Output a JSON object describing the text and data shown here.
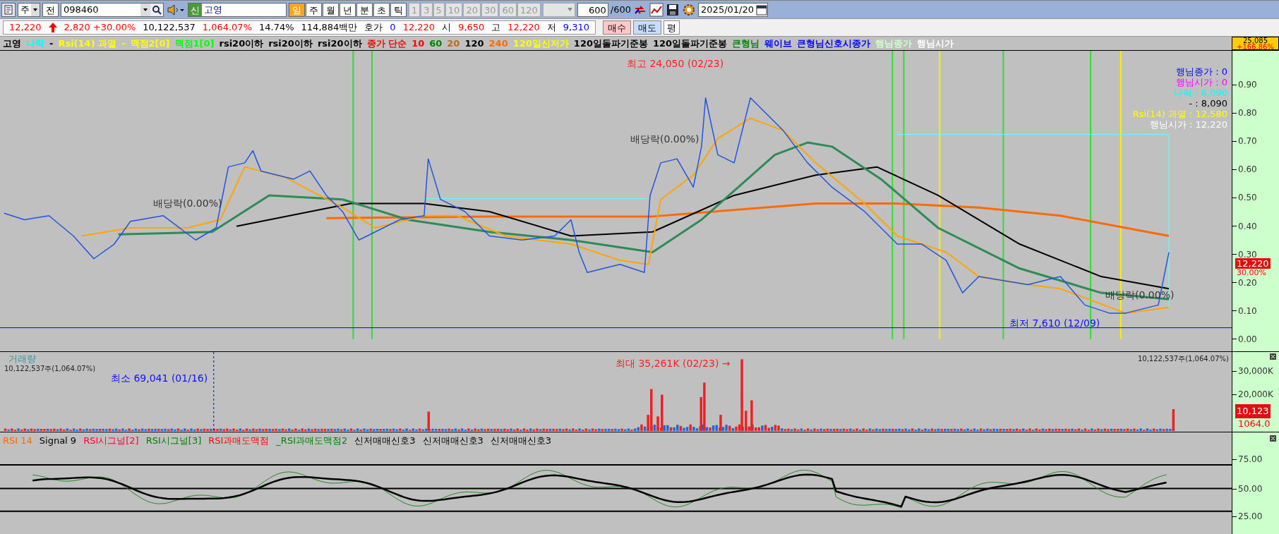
{
  "toolbar": {
    "market": "주",
    "prev_button": "전",
    "code": "098460",
    "name_badge": "신",
    "name": "고영",
    "periods": [
      {
        "label": "일",
        "selected": true
      },
      {
        "label": "주",
        "selected": false
      },
      {
        "label": "월",
        "selected": false
      },
      {
        "label": "년",
        "selected": false
      },
      {
        "label": "분",
        "selected": false
      },
      {
        "label": "초",
        "selected": false
      },
      {
        "label": "틱",
        "selected": false
      }
    ],
    "intervals": [
      {
        "label": "1",
        "disabled": true
      },
      {
        "label": "3",
        "disabled": true
      },
      {
        "label": "5",
        "disabled": true
      },
      {
        "label": "10",
        "disabled": true
      },
      {
        "label": "20",
        "disabled": true
      },
      {
        "label": "30",
        "disabled": true
      },
      {
        "label": "60",
        "disabled": true
      },
      {
        "label": "120",
        "disabled": true
      }
    ],
    "count": "600",
    "count_total": "/600",
    "date": "2025/01/20"
  },
  "quote_bar": {
    "items": [
      {
        "text": "12,220",
        "kind": "rise"
      },
      {
        "text": "2,820 +30.00%",
        "kind": "rise"
      },
      {
        "text": "10,122,537",
        "kind": "neutral"
      },
      {
        "text": "1,064.07%",
        "kind": "rise"
      },
      {
        "text": "14.74%",
        "kind": "neutral"
      },
      {
        "text": "114,884백만",
        "kind": "neutral"
      },
      {
        "text": "호가",
        "kind": "neutral"
      },
      {
        "text": "0",
        "kind": "fall"
      },
      {
        "text": "12,220",
        "kind": "rise"
      },
      {
        "text": "시",
        "kind": "neutral"
      },
      {
        "text": "9,650",
        "kind": "rise"
      },
      {
        "text": "고",
        "kind": "neutral"
      },
      {
        "text": "12,220",
        "kind": "rise"
      },
      {
        "text": "저",
        "kind": "neutral"
      },
      {
        "text": "9,310",
        "kind": "fall"
      }
    ],
    "buttons": [
      {
        "label": "매수",
        "kind": "buy"
      },
      {
        "label": "매도",
        "kind": "sell"
      },
      {
        "label": "평",
        "kind": "plain"
      }
    ]
  },
  "legend": [
    {
      "text": "고영",
      "color": "#000000"
    },
    {
      "text": "나락",
      "color": "#00ffff"
    },
    {
      "text": "-",
      "color": "#000000"
    },
    {
      "text": "Rsi(14) 과열",
      "color": "#ffff00"
    },
    {
      "text": "-",
      "color": "#ffff00"
    },
    {
      "text": "맥점2[0]",
      "color": "#ffff00"
    },
    {
      "text": "맥점1[0]",
      "color": "#00ff00"
    },
    {
      "text": "rsi20이하",
      "color": "#000000"
    },
    {
      "text": "rsi20이하",
      "color": "#000000"
    },
    {
      "text": "rsi20이하",
      "color": "#000000"
    },
    {
      "text": "종가 단순",
      "color": "#ff0000"
    },
    {
      "text": "10",
      "color": "#ff0000"
    },
    {
      "text": "60",
      "color": "#008000"
    },
    {
      "text": "20",
      "color": "#b86e00"
    },
    {
      "text": "120",
      "color": "#000000"
    },
    {
      "text": "240",
      "color": "#ff6a00"
    },
    {
      "text": "120일신저가",
      "color": "#ffff00"
    },
    {
      "text": "120일돌파기준봉",
      "color": "#000000"
    },
    {
      "text": "120일돌파기준봉",
      "color": "#000000"
    },
    {
      "text": "큰형님",
      "color": "#008800"
    },
    {
      "text": "웨이브",
      "color": "#0000ff"
    },
    {
      "text": "큰형님신호시종가",
      "color": "#0000ff"
    },
    {
      "text": "행님종가",
      "color": "#ccffcc"
    },
    {
      "text": "행님시가",
      "color": "#ffffff"
    }
  ],
  "price_panel": {
    "high_price": "25,085",
    "high_change": "+166.86%",
    "annotations": [
      {
        "text": "최고 24,050 (02/23)",
        "kind": "high"
      },
      {
        "text": "배당락(0.00%)",
        "kind": "dividend"
      },
      {
        "text": "배당락(0.00%)",
        "kind": "dividend"
      },
      {
        "text": "배당락(0.00%)",
        "kind": "dividend"
      },
      {
        "text": "최저 7,610 (12/09)",
        "kind": "low"
      }
    ],
    "overlay_texts": [
      {
        "text": "행님종가 : 0",
        "color": "#0000ff"
      },
      {
        "text": "행님시가 : 0",
        "color": "#ff00ff"
      },
      {
        "text": "나락 : 8,090",
        "color": "#00ffff"
      },
      {
        "text": "- : 8,090",
        "color": "#000000"
      },
      {
        "text": "Rsi(14) 과열 : 12,580",
        "color": "#ffff00"
      },
      {
        "text": "행님시가 : 12,220",
        "color": "#ffffff"
      }
    ],
    "axis_labels": [
      "0.90",
      "0.80",
      "0.70",
      "0.60",
      "0.50",
      "0.40",
      "0.30",
      "0.20",
      "0.10",
      "0.00"
    ],
    "current_price": "12,220",
    "current_change": "30.00%"
  },
  "volume_panel": {
    "title": "거래량",
    "volume_text": "10,122,537주(1,064.07%)",
    "volume_text_right": "10,122,537주(1,064.07%)",
    "max_label": "최대 35,261K (02/23) →",
    "min_label": "최소 69,041 (01/16)",
    "axis_labels": [
      "30,000K",
      "20,000K"
    ],
    "current_volume": "10,123",
    "current_ratio": "1064.0"
  },
  "rsi_panel": {
    "legend": [
      {
        "text": "RSI 14",
        "color": "#ff6600"
      },
      {
        "text": "Signal 9",
        "color": "#000000"
      },
      {
        "text": "RSI시그널[2]",
        "color": "#ff0033"
      },
      {
        "text": "RSI시그널[3]",
        "color": "#008000"
      },
      {
        "text": "RSI과매도맥점",
        "color": "#ff0000"
      },
      {
        "text": "_RSI과매도맥점2",
        "color": "#008000"
      },
      {
        "text": "신저매매신호3",
        "color": "#000000"
      },
      {
        "text": "신저매매신호3",
        "color": "#000000"
      },
      {
        "text": "신저매매신호3",
        "color": "#000000"
      }
    ],
    "axis_labels": [
      "75.00",
      "50.00",
      "25.00"
    ]
  }
}
